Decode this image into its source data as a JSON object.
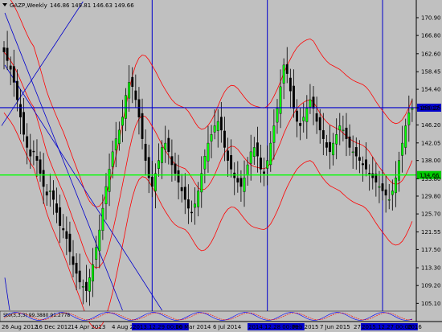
{
  "header": {
    "symbol_label": "GAZP,Weekly",
    "ohlc_label": "146.86 149.81 146.63 149.66"
  },
  "colors": {
    "background": "#c0c0c0",
    "bull_candle": "#00ff00",
    "bear_candle": "#000000",
    "wick": "#000000",
    "envelope": "#ff0000",
    "ma": "#ff0000",
    "hline_price": "#0000cc",
    "hline_support": "#00ff00",
    "vline": "#0000cc",
    "trendline": "#0000cc",
    "stoch_main": "#0000ff",
    "stoch_signal": "#ff0000",
    "price_tag_blue": "#0000cc",
    "price_tag_green": "#00cc00"
  },
  "indicator_label": "Sto(3,3,3) 99.3880 91.2778",
  "chart_data": {
    "type": "candlestick",
    "y_ticks": [
      "170.90",
      "166.80",
      "162.60",
      "158.45",
      "154.40",
      "150.15",
      "146.20",
      "142.05",
      "138.00",
      "133.80",
      "129.80",
      "125.70",
      "121.55",
      "117.50",
      "113.30",
      "109.20",
      "105.10"
    ],
    "ylim": [
      103.5,
      174.6
    ],
    "x_labels": [
      "26 Aug 2012",
      "16 Dec 2012",
      "14 Apr 2013",
      "4 Aug 2013",
      "2013.12.29 00:00",
      "16 Mar 2014",
      "6 Jul 2014",
      "2014.12.28 00:00",
      "Feb 2015",
      "7 Jun 2015",
      "27",
      "2015.12.27 00:00",
      "2016"
    ],
    "x_label_highlight": [
      false,
      false,
      false,
      false,
      true,
      false,
      false,
      true,
      false,
      false,
      false,
      true,
      false
    ],
    "price_level_tags": [
      {
        "name": "blue",
        "value": "150.17",
        "price": 150.17
      },
      {
        "name": "green",
        "value": "134.66",
        "price": 134.66
      }
    ],
    "vertical_lines_at_bar": [
      45,
      80,
      115
    ],
    "close_series_sketch": [
      163,
      161,
      159,
      156,
      152,
      148,
      144,
      141,
      139,
      140,
      138,
      135,
      132,
      130,
      131,
      129,
      126,
      123,
      122,
      120,
      117,
      114,
      112,
      110,
      109,
      108,
      111,
      114,
      118,
      122,
      127,
      132,
      136,
      140,
      143,
      145,
      148,
      153,
      156,
      155,
      152,
      148,
      143,
      138,
      134,
      132,
      135,
      138,
      141,
      142,
      140,
      137,
      135,
      133,
      131,
      129,
      127,
      126,
      128,
      131,
      135,
      139,
      142,
      144,
      146,
      147,
      145,
      141,
      138,
      136,
      134,
      133,
      132,
      134,
      137,
      140,
      141,
      139,
      136,
      135,
      138,
      142,
      146,
      150,
      155,
      160,
      158,
      154,
      150,
      147,
      146,
      148,
      150,
      152,
      150,
      147,
      145,
      143,
      141,
      140,
      142,
      144,
      146,
      145,
      143,
      141,
      140,
      139,
      138,
      137,
      136,
      135,
      134,
      133,
      132,
      131,
      130,
      129,
      131,
      134,
      138,
      142,
      146,
      149,
      150
    ]
  }
}
